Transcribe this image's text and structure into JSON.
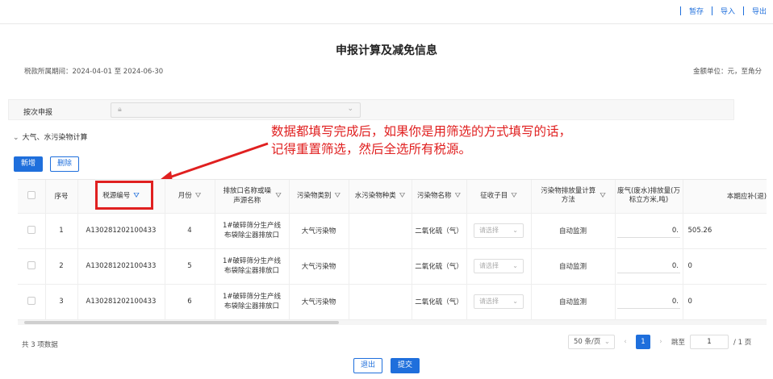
{
  "toolbar": {
    "save": "暂存",
    "import": "导入",
    "export": "导出"
  },
  "page": {
    "title": "申报计算及减免信息",
    "period": "税款所属期间：2024-04-01 至 2024-06-30",
    "unit": "金额单位：元，至角分"
  },
  "filter": {
    "label": "按次申报",
    "lock_icon": "lock-icon"
  },
  "section": {
    "title": "大气、水污染物计算"
  },
  "actions": {
    "add": "新增",
    "delete": "删除"
  },
  "annotation": {
    "line1": "数据都填写完成后，如果你是用筛选的方式填写的话，",
    "line2": "记得重置筛选，然后全选所有税源。",
    "color": "#e02020"
  },
  "table": {
    "headers": {
      "seq": "序号",
      "tax_source": "税源编号",
      "month": "月份",
      "outlet": "排放口名称或噪声源名称",
      "category": "污染物类别",
      "water_type": "水污染物种类",
      "pollutant": "污染物名称",
      "sub_item": "征收子目",
      "method": "污染物排放量计算方法",
      "volume": "废气(废水)排放量(万标立方米,吨)",
      "payable": "本期应补(退)税额"
    },
    "rows": [
      {
        "seq": "1",
        "tax_source": "A130281202100433",
        "month": "4",
        "outlet": "1#破碎筛分生产线布袋除尘器排放口",
        "category": "大气污染物",
        "water_type": "",
        "pollutant": "二氧化硫（气）",
        "sub_item": "请选择",
        "method": "自动监测",
        "volume": "0.",
        "payable": "505.26"
      },
      {
        "seq": "2",
        "tax_source": "A130281202100433",
        "month": "5",
        "outlet": "1#破碎筛分生产线布袋除尘器排放口",
        "category": "大气污染物",
        "water_type": "",
        "pollutant": "二氧化硫（气）",
        "sub_item": "请选择",
        "method": "自动监测",
        "volume": "0.",
        "payable": "0"
      },
      {
        "seq": "3",
        "tax_source": "A130281202100433",
        "month": "6",
        "outlet": "1#破碎筛分生产线布袋除尘器排放口",
        "category": "大气污染物",
        "water_type": "",
        "pollutant": "二氧化硫（气）",
        "sub_item": "请选择",
        "method": "自动监测",
        "volume": "0.",
        "payable": "0"
      }
    ]
  },
  "pagination": {
    "total": "共 3 项数据",
    "page_size": "50 条/页",
    "current_page": "1",
    "goto_label": "跳至",
    "goto_value": "1",
    "total_pages": "/ 1 页"
  },
  "footer": {
    "exit": "退出",
    "submit": "提交"
  },
  "colors": {
    "primary": "#1f6fdc",
    "annotation": "#e02020"
  }
}
